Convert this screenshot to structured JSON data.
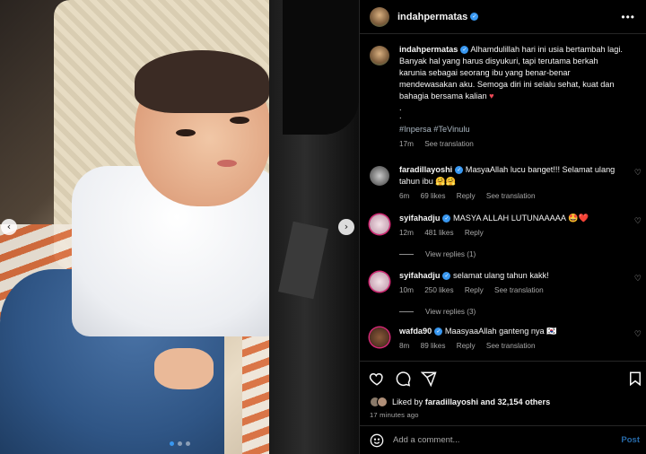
{
  "colors": {
    "accent": "#3897f0",
    "background": "#000000",
    "heart": "#ed4956"
  },
  "media": {
    "dots_total": 3,
    "dots_active_index": 0
  },
  "header": {
    "username": "indahpermatas",
    "more_icon": "more-horizontal-icon"
  },
  "caption": {
    "username": "indahpermatas",
    "text": "Alhamdulillah hari ini usia bertambah lagi. Banyak hal yang harus disyukuri, tapi terutama berkah karunia sebagai seorang ibu yang benar-benar mendewasakan aku. Semoga diri ini selalu sehat, kuat dan bahagia bersama kalian",
    "dots": ".\n.",
    "hashtags": "#Inpersa #TeVinulu",
    "time": "17m",
    "see_translation": "See translation"
  },
  "comments": [
    {
      "username": "faradillayoshi",
      "text": "MasyaAllah lucu banget!!! Selamat ulang tahun ibu 🤗🤗",
      "time": "6m",
      "likes": "69 likes",
      "reply": "Reply",
      "translation": "See translation"
    },
    {
      "username": "syifahadju",
      "text": "MASYA ALLAH LUTUNAAAAA 🤩❤️",
      "time": "12m",
      "likes": "481 likes",
      "reply": "Reply",
      "view_replies": "View replies (1)"
    },
    {
      "username": "syifahadju",
      "text": "selamat ulang tahun kakk!",
      "time": "10m",
      "likes": "250 likes",
      "reply": "Reply",
      "translation": "See translation",
      "view_replies": "View replies (3)"
    },
    {
      "username": "wafda90",
      "text": "MaasyaaAllah ganteng nya 🇰🇷",
      "time": "8m",
      "likes": "89 likes",
      "reply": "Reply",
      "translation": "See translation"
    }
  ],
  "actions": {
    "liked_by_prefix": "Liked by",
    "liked_by_user": "faradillayoshi",
    "liked_by_suffix": "and 32,154 others",
    "posted_ago": "17 minutes ago"
  },
  "add_comment": {
    "placeholder": "Add a comment...",
    "post_label": "Post"
  }
}
